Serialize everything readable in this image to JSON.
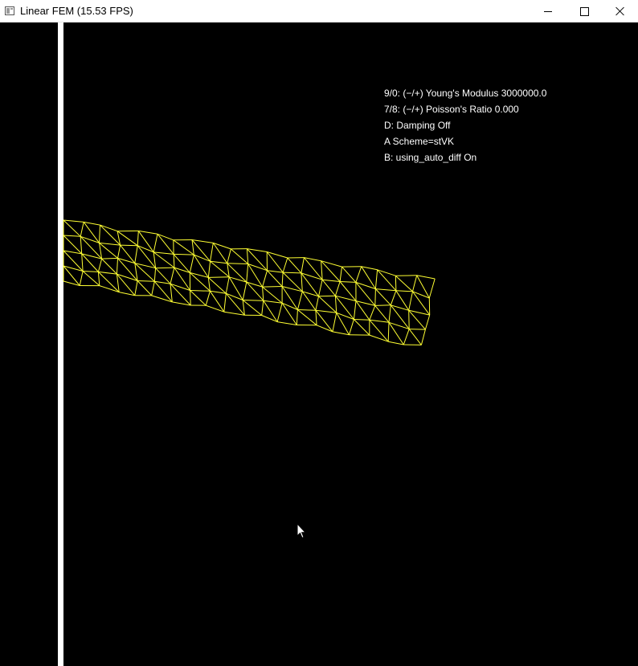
{
  "window": {
    "title": "Linear FEM (15.53 FPS)",
    "icon": "app-window-icon",
    "controls": {
      "minimize": "minimize-icon",
      "maximize": "maximize-icon",
      "close": "close-icon"
    }
  },
  "hud": {
    "lines": [
      "9/0: (−/+) Young's Modulus 3000000.0",
      "7/8: (−/+) Poisson's Ratio 0.000",
      "D: Damping Off",
      "A Scheme=stVK",
      "B: using_auto_diff On"
    ]
  },
  "colors": {
    "background": "#000000",
    "wall": "#ffffff",
    "mesh": "#ffff33",
    "text": "#ffffff"
  },
  "mesh": {
    "columns": 20,
    "rows": 4,
    "fixed_edge": "left"
  },
  "cursor": {
    "icon": "mouse-pointer-icon"
  }
}
